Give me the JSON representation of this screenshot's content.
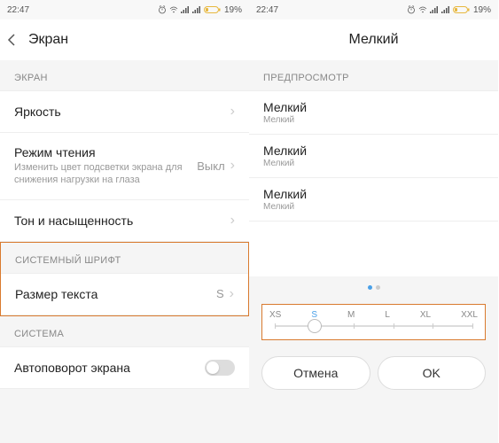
{
  "statusbar": {
    "time": "22:47",
    "battery": "19%"
  },
  "left": {
    "title": "Экран",
    "section_screen": "ЭКРАН",
    "brightness": "Яркость",
    "reading_mode": "Режим чтения",
    "reading_sub": "Изменить цвет подсветки экрана для снижения нагрузки на глаза",
    "reading_val": "Выкл",
    "tone": "Тон и насыщенность",
    "section_font": "СИСТЕМНЫЙ ШРИФТ",
    "text_size": "Размер текста",
    "text_size_val": "S",
    "section_system": "СИСТЕМА",
    "autorotate": "Автоповорот экрана"
  },
  "right": {
    "title": "Мелкий",
    "section_preview": "ПРЕДПРОСМОТР",
    "preview": [
      {
        "t": "Мелкий",
        "s": "Мелкий"
      },
      {
        "t": "Мелкий",
        "s": "Мелкий"
      },
      {
        "t": "Мелкий",
        "s": "Мелкий"
      }
    ],
    "sizes": [
      "XS",
      "S",
      "M",
      "L",
      "XL",
      "XXL"
    ],
    "cancel": "Отмена",
    "ok": "OK"
  }
}
